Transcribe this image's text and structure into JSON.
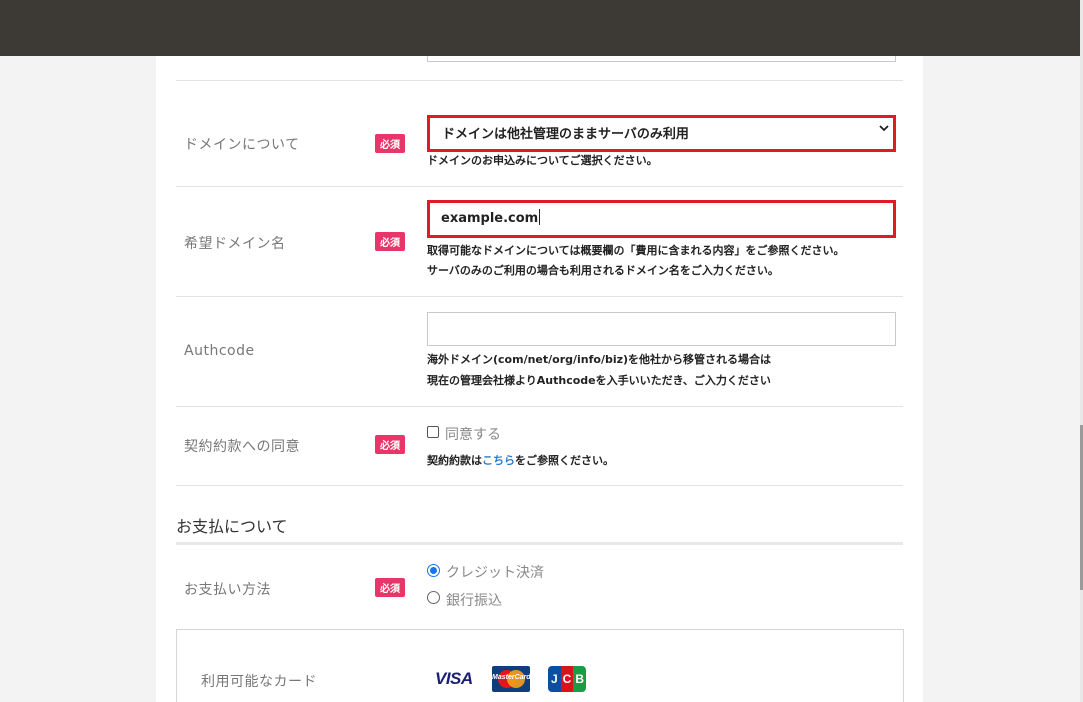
{
  "domain_row": {
    "label": "ドメインについて",
    "required": "必須",
    "select_value": "ドメインは他社管理のままサーバのみ利用",
    "help": "ドメインのお申込みについてご選択ください。"
  },
  "domain_name_row": {
    "label": "希望ドメイン名",
    "required": "必須",
    "value": "example.com",
    "help1": "取得可能なドメインについては概要欄の「費用に含まれる内容」をご参照ください。",
    "help2": "サーバのみのご利用の場合も利用されるドメイン名をご入力ください。"
  },
  "authcode_row": {
    "label": "Authcode",
    "value": "",
    "help1": "海外ドメイン(com/net/org/info/biz)を他社から移管される場合は",
    "help2": "現在の管理会社様よりAuthcodeを入手いいただき、ご入力ください"
  },
  "terms_row": {
    "label": "契約約款への同意",
    "required": "必須",
    "checkbox_label": "同意する",
    "help_prefix": "契約約款は",
    "help_link": "こちら",
    "help_suffix": "をご参照ください。"
  },
  "payment_section": {
    "title": "お支払について"
  },
  "payment_row": {
    "label": "お支払い方法",
    "required": "必須",
    "options": [
      "クレジット決済",
      "銀行振込"
    ],
    "selected": "クレジット決済"
  },
  "cards_row": {
    "label": "利用可能なカード",
    "cards": [
      "VISA",
      "MasterCard",
      "JCB"
    ],
    "visa_text": "VISA",
    "mastercard_text": "MasterCard",
    "jcb_letters": [
      "J",
      "C",
      "B"
    ]
  },
  "colors": {
    "topbar": "#3d3935",
    "required_badge": "#e8366a",
    "highlight_border": "#e01b22",
    "link": "#2a7bd0",
    "radio_checked": "#1a73e8"
  }
}
